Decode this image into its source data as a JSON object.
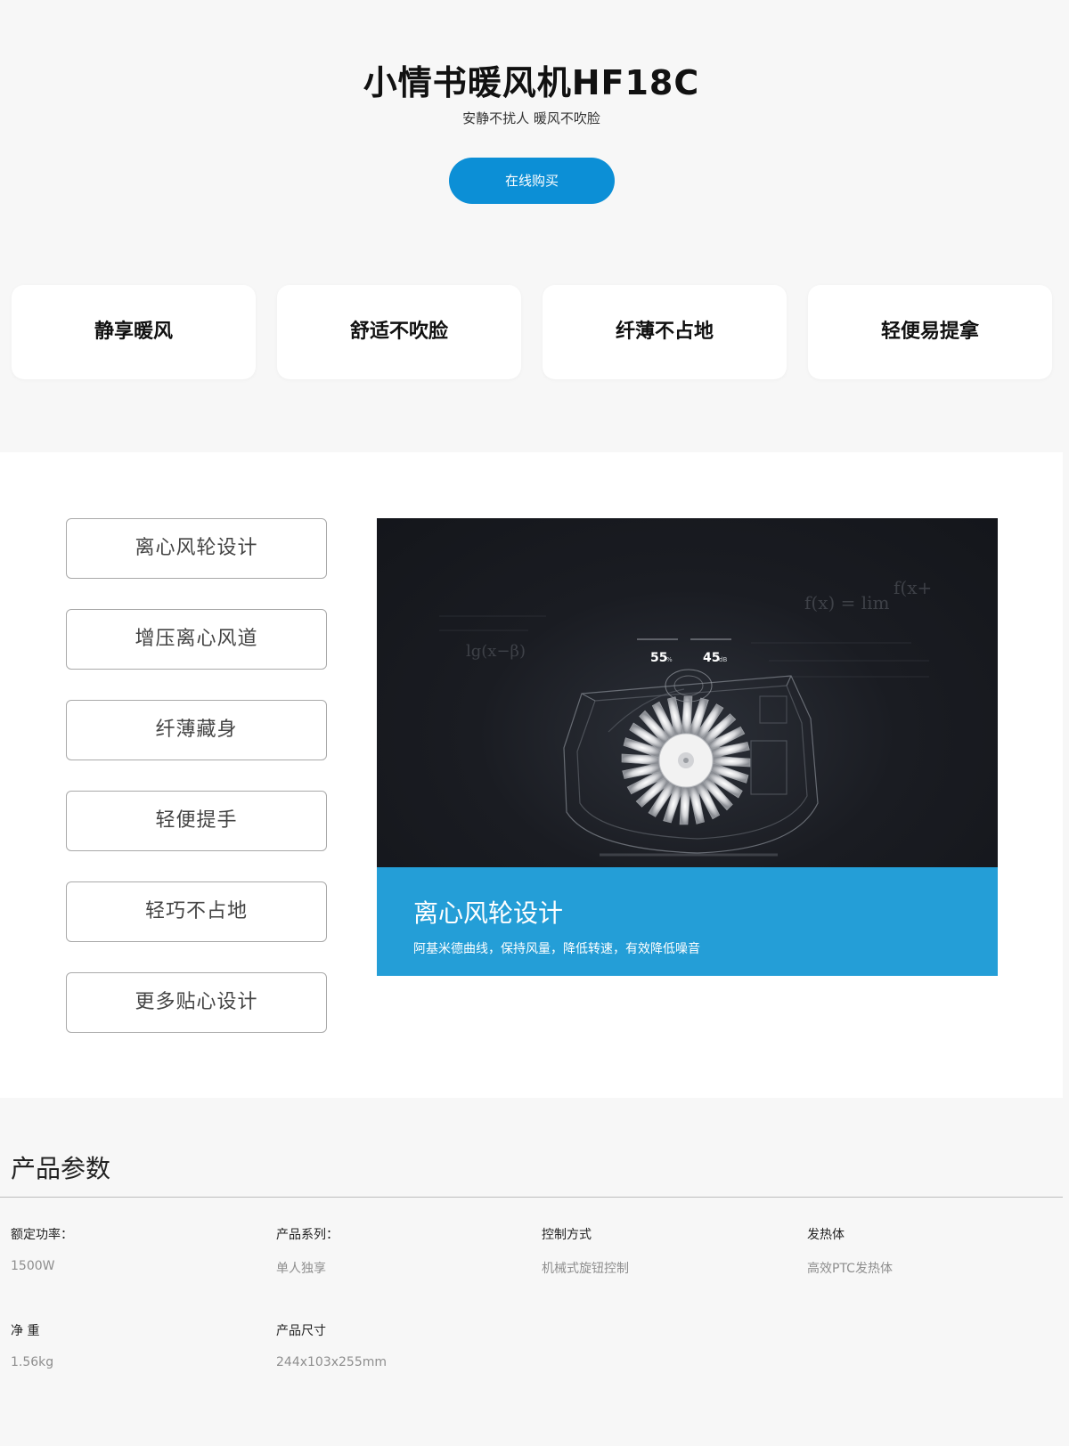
{
  "hero": {
    "title": "小情书暖风机HF18C",
    "subtitle": "安静不扰人 暖风不吹脸",
    "buy_label": "在线购买"
  },
  "features": [
    "静享暖风",
    "舒适不吹脸",
    "纤薄不占地",
    "轻便易提拿"
  ],
  "design_tabs": [
    "离心风轮设计",
    "增压离心风道",
    "纤薄藏身",
    "轻便提手",
    "轻巧不占地",
    "更多贴心设计"
  ],
  "showcase": {
    "stat_left_value": "55",
    "stat_left_unit": "%",
    "stat_right_value": "45",
    "stat_right_unit": "dB",
    "formula_1": "f(x) = lim",
    "formula_2": "f(x+",
    "formula_3": "lg(x−β)",
    "caption_title": "离心风轮设计",
    "caption_desc": "阿基米德曲线，保持风量，降低转速，有效降低噪音"
  },
  "params": {
    "title": "产品参数",
    "items": [
      {
        "label": "额定功率：",
        "value": "1500W"
      },
      {
        "label": "产品系列：",
        "value": "单人独享"
      },
      {
        "label": "控制方式",
        "value": "机械式旋钮控制"
      },
      {
        "label": "发热体",
        "value": "高效PTC发热体"
      },
      {
        "label": "净 重",
        "value": "1.56kg"
      },
      {
        "label": "产品尺寸",
        "value": "244x103x255mm"
      }
    ]
  },
  "colors": {
    "accent": "#0c8fd6",
    "caption_bg": "#249ed7",
    "page_bg": "#f7f7f7"
  }
}
